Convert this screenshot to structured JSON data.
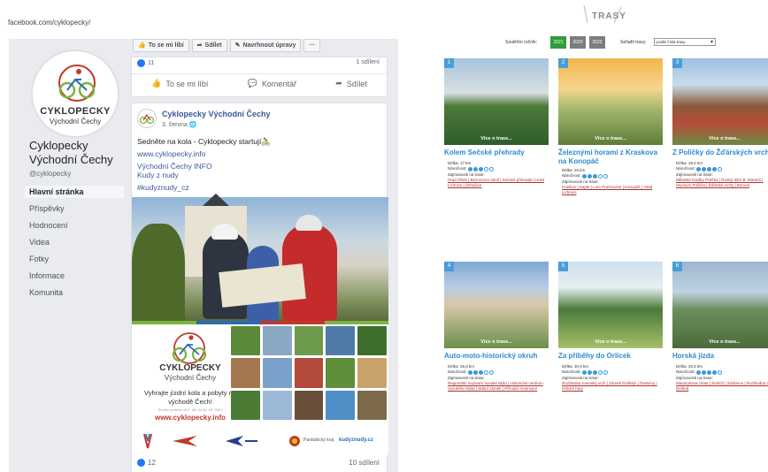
{
  "fb": {
    "url": "facebook.com/cyklopecky/",
    "logo": {
      "title": "CYKLOPECKY",
      "subtitle": "Východní Čechy"
    },
    "page_name": "Cyklopecky Východní Čechy",
    "handle": "@cyklopecky",
    "nav": [
      "Hlavní stránka",
      "Příspěvky",
      "Hodnocení",
      "Videa",
      "Fotky",
      "Informace",
      "Komunita"
    ],
    "action_bar": {
      "like": "To se mi líbí",
      "share": "Sdílet",
      "suggest": "Navrhnout úpravy",
      "more": "···"
    },
    "prev_post": {
      "likes": "11",
      "shares": "1 sdílení"
    },
    "reactions": {
      "like": "To se mi líbí",
      "comment": "Komentář",
      "share": "Sdílet"
    },
    "post": {
      "author": "Cyklopecky Východní Čechy",
      "date": "3. června",
      "text": "Sedněte na kola - Cyklopecky startují🚴",
      "link": "www.cyklopecky.info",
      "line3": "Východní Čechy INFO",
      "line4": "Kudy z nudy",
      "hashtag": "#kudyznudy_cz",
      "poster": {
        "title": "CYKLOPECKY",
        "subtitle": "Východní Čechy",
        "slogan": "Vyhrajte jízdní kola a pobyty na východě Čech!",
        "small": "Soutěž probíhá od 1. 06. do 30. 09. 2021",
        "url": "www.cyklopecky.info"
      },
      "partners": {
        "kraj": "Pardubický kraj",
        "kudyznudy": "kudyznudy.cz"
      },
      "likes": "12",
      "shares": "10 sdílení"
    }
  },
  "trasy": {
    "title": "TRASY",
    "filter_label": "Soutěžní ročník:",
    "years": [
      "2021",
      "2020",
      "2022"
    ],
    "sort_label": "Seřadit trasy:",
    "sort_value": "podle čísla trasy",
    "more": "Více o trase...",
    "routes": [
      {
        "num": "1",
        "name": "Kolem Sečské přehrady",
        "distance": "Délka: 17 km",
        "difficulty_label": "Náročnost:",
        "difficulty": 3,
        "sights_label": "Zajímavosti na trase:",
        "sights": "Hrad Oheb | Bezručovo údolí | Sečská přehrada | Hrad Lichnice | Žehušice"
      },
      {
        "num": "2",
        "name": "Železnými horami z Kraskova na Konopáč",
        "distance": "Délka: 26 km",
        "difficulty_label": "Náročnost:",
        "difficulty": 3,
        "sights_label": "Zajímavosti na trase:",
        "sights": "Kraskov | Kaple | Lom Prachovice | Konopáč | Hrad Lichnice"
      },
      {
        "num": "3",
        "name": "Z Poličky do Žďárských vrchů",
        "distance": "Délka: 28,2 km",
        "difficulty_label": "Náročnost:",
        "difficulty": 4,
        "sights_label": "Zajímavosti na trase:",
        "sights": "Městské hradby Polička | Rodný dům B. Martinů | Muzeum Polička | Žďárské vrchy | Borová"
      },
      {
        "num": "4",
        "name": "Auto-moto-historický okruh",
        "distance": "Délka: 35,8 km",
        "difficulty_label": "Náročnost:",
        "difficulty": 3,
        "sights_label": "Zajímavosti na trase:",
        "sights": "Regionální muzeum Vysoké Mýto | Historické centrum Vysokého Mýta | Státní zámek | Přírodní rezervace"
      },
      {
        "num": "5",
        "name": "Za příběhy do Orlicek",
        "distance": "Délka: 30,9 km",
        "difficulty_label": "Náročnost:",
        "difficulty": 3,
        "sights_label": "Zajímavosti na trase:",
        "sights": "Rozhledna Anenský vrch | Zámek Potštejn | Pastviny | Orlické hory"
      },
      {
        "num": "6",
        "name": "Horská jízda",
        "distance": "Délka: 20,5 km",
        "difficulty_label": "Náročnost:",
        "difficulty": 4,
        "sights_label": "Zajímavosti na trase:",
        "sights": "Masarykova chata | Šerlich | Zdobnice | Rozhledna Velká Deštná"
      }
    ]
  },
  "colors": {
    "fb_blue": "#385898",
    "route_blue": "#2a8bd2",
    "year_active": "#2e9e3c",
    "year_inactive": "#7d7d7d"
  }
}
